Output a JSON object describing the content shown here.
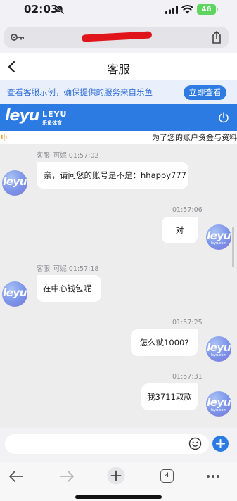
{
  "status_bar": {
    "time": "02:03",
    "battery": "46"
  },
  "browser": {
    "url": "",
    "tab_count": "4"
  },
  "header": {
    "title": "客服"
  },
  "notice": {
    "text": "查看客服示例，确保提供的服务来自乐鱼",
    "button": "立即查看"
  },
  "brand": {
    "logo_main": "leyu",
    "logo_en": "LEYU",
    "logo_cn": "乐鱼体育"
  },
  "marquee": {
    "text": "为了您的账户资金与资料"
  },
  "avatar": {
    "text": "leyu",
    "subtext": "leyu.com"
  },
  "messages": [
    {
      "side": "agent",
      "meta": "客服–可妮  01:57:02",
      "text": "亲，请问您的账号是不是：hhappy777"
    },
    {
      "side": "user",
      "meta": "01:57:06",
      "text": "对"
    },
    {
      "side": "agent",
      "meta": "客服–可妮  01:57:18",
      "text": "在中心钱包呢"
    },
    {
      "side": "user",
      "meta": "01:57:25",
      "text": "怎么就1000?"
    },
    {
      "side": "user",
      "meta": "01:57:31",
      "text": "我3711取款"
    }
  ],
  "composer": {
    "placeholder": ""
  },
  "colors": {
    "brand": "#2c7be3",
    "chat_bg": "#ededed",
    "notice_text": "#2d6bd8"
  },
  "icons": [
    "bell-off-icon",
    "signal-icon",
    "wifi-icon",
    "key-icon",
    "share-icon",
    "back-icon",
    "power-icon",
    "speaker-icon",
    "emoji-icon",
    "plus-icon",
    "arrow-left-icon",
    "arrow-right-icon",
    "new-tab-icon",
    "tabs-icon",
    "more-icon"
  ]
}
